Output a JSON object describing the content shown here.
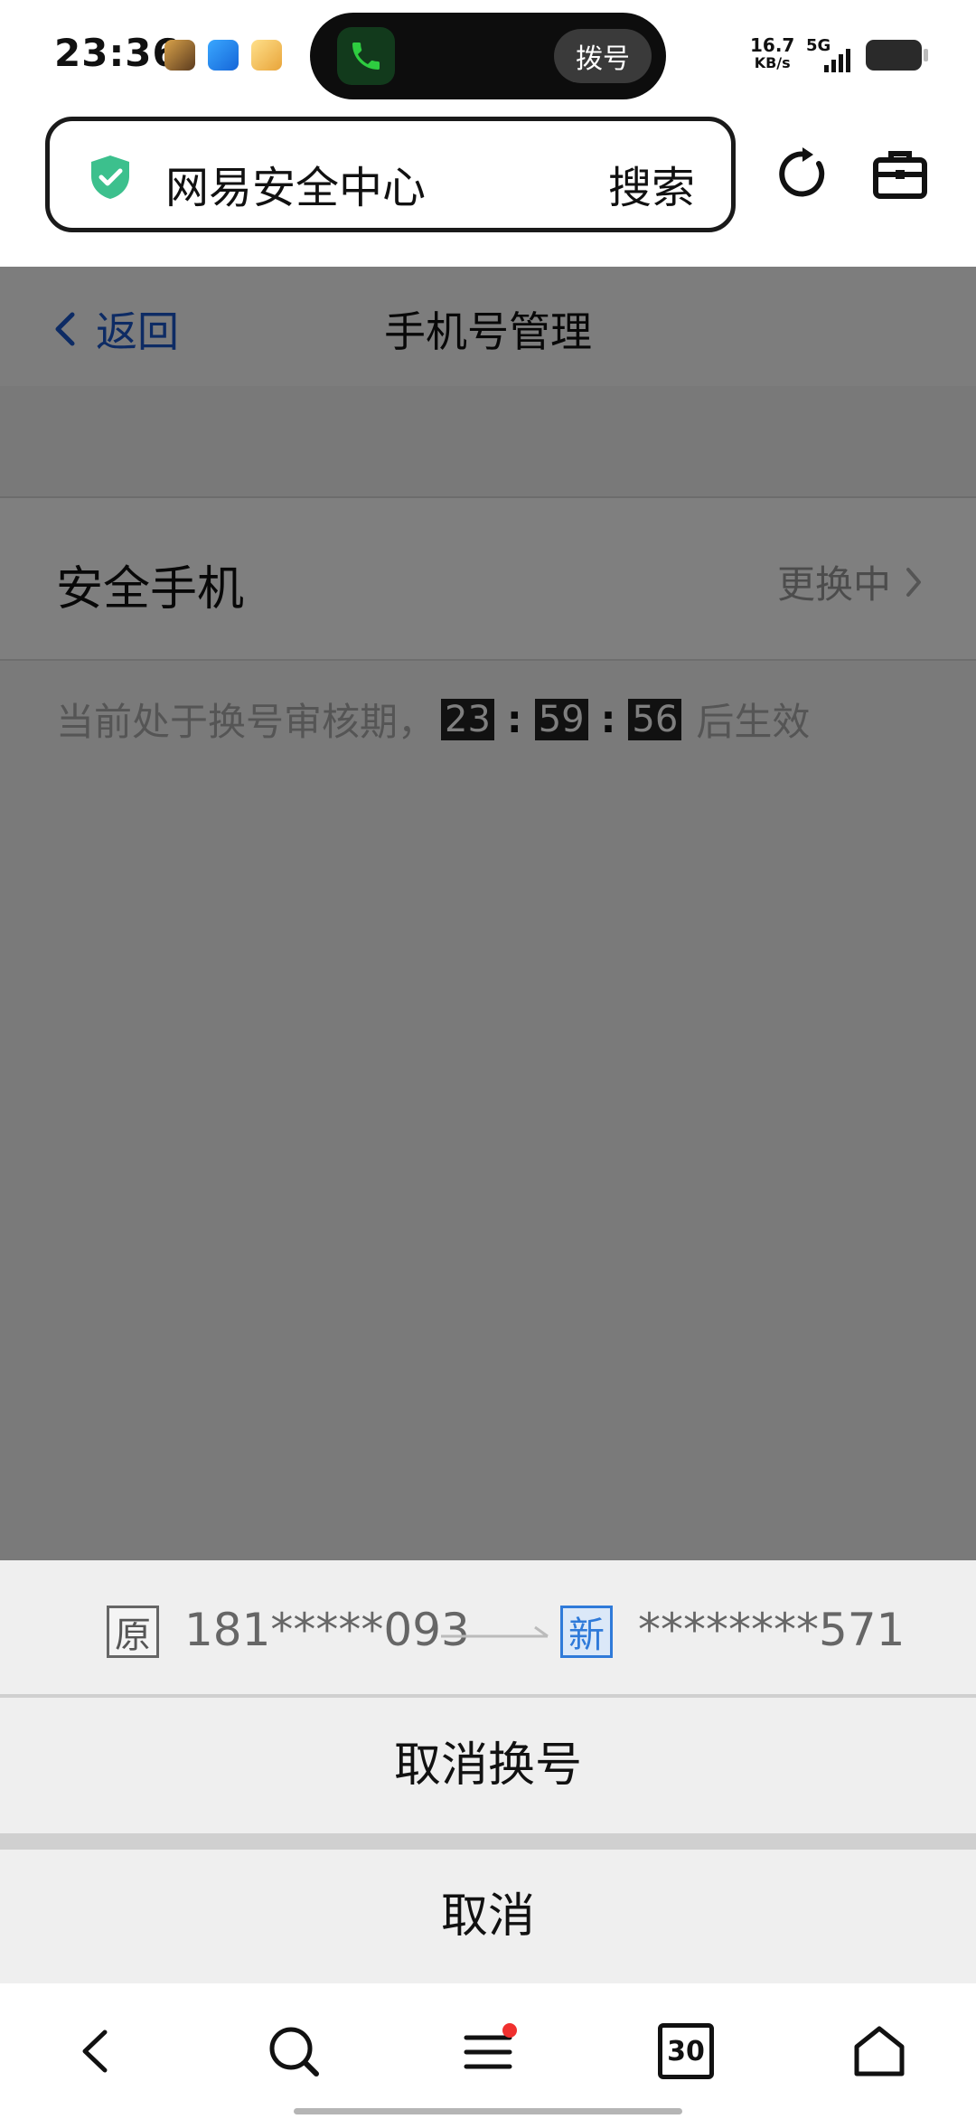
{
  "status_bar": {
    "time": "23:36",
    "call_button": "拨号",
    "net_speed_value": "16.7",
    "net_speed_unit": "KB/s",
    "network": "5G"
  },
  "browser": {
    "address_text": "网易安全中心",
    "search_label": "搜索"
  },
  "page": {
    "back_label": "返回",
    "title": "手机号管理",
    "row_label": "安全手机",
    "row_status": "更换中",
    "notice_prefix": "当前处于换号审核期，",
    "countdown": {
      "hours": "23",
      "minutes": "59",
      "seconds": "56"
    },
    "countdown_sep": ":",
    "notice_suffix": "后生效"
  },
  "sheet": {
    "old_tag": "原",
    "old_number": "181*****093",
    "new_tag": "新",
    "new_number": "********571",
    "cancel_change_label": "取消换号",
    "cancel_label": "取消"
  },
  "bottom_nav": {
    "tabs_count": "30"
  },
  "colors": {
    "accent_blue": "#1a56c8",
    "shield_green": "#3cc08d",
    "badge_red": "#f0302e"
  }
}
